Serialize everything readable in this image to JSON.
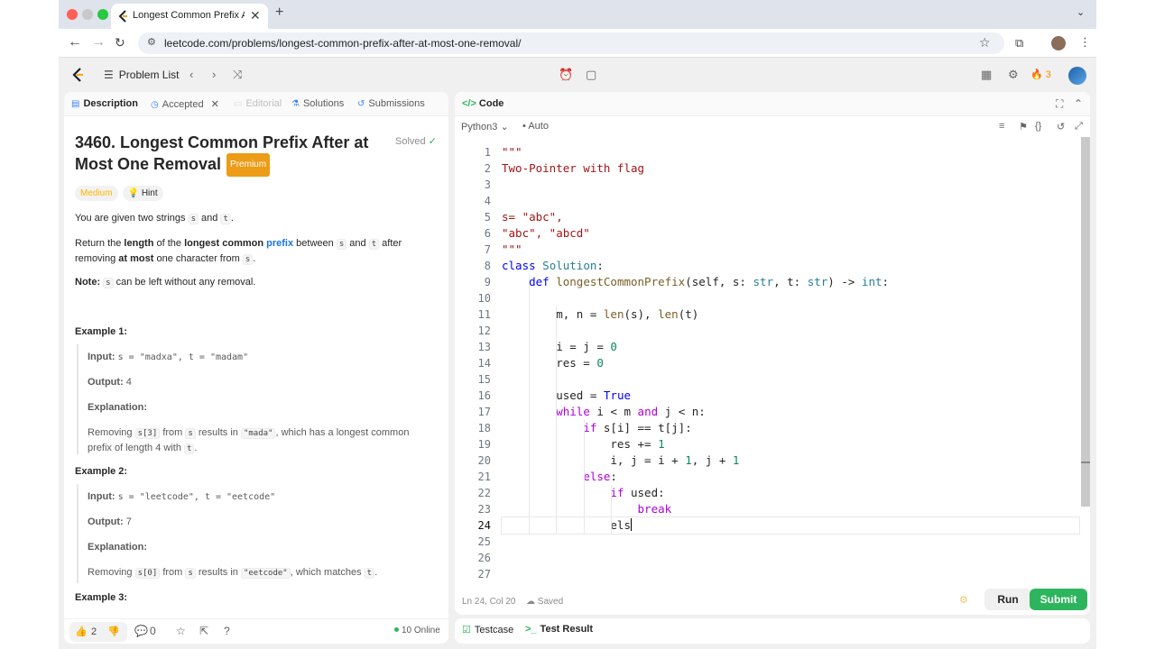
{
  "browser": {
    "tab_title": "Longest Common Prefix After",
    "tab_close": "✕",
    "new_tab": "+",
    "url": "leetcode.com/problems/longest-common-prefix-after-at-most-one-removal/",
    "colors": {
      "close": "#ff5f57",
      "min": "#febc2e",
      "max": "#28c840"
    }
  },
  "nav": {
    "problem_list": "Problem List",
    "streak_count": "3"
  },
  "left_tabs": {
    "description": "Description",
    "accepted": "Accepted",
    "editorial": "Editorial",
    "solutions": "Solutions",
    "submissions": "Submissions"
  },
  "problem": {
    "title": "3460. Longest Common Prefix After at Most One Removal",
    "premium": "Premium",
    "solved": "Solved",
    "difficulty": "Medium",
    "hint": "Hint",
    "intro_a": "You are given two strings ",
    "intro_s": "s",
    "intro_and": " and ",
    "intro_t": "t",
    "intro_end": ".",
    "ret_1": "Return the ",
    "ret_length": "length",
    "ret_2": " of the ",
    "ret_longest": "longest common",
    "ret_prefix": "prefix",
    "ret_3": " between ",
    "ret_s": "s",
    "ret_4": " and ",
    "ret_t": "t",
    "ret_5": " after removing ",
    "ret_most": "at most",
    "ret_6": " one character from ",
    "ret_s2": "s",
    "ret_7": ".",
    "note_label": "Note:",
    "note_s": "s",
    "note_text": " can be left without any removal."
  },
  "examples": {
    "ex1_title": "Example 1:",
    "ex1_input_label": "Input:",
    "ex1_input": "s = \"madxa\", t = \"madam\"",
    "ex1_output_label": "Output:",
    "ex1_output": "4",
    "ex1_expl_label": "Explanation:",
    "ex1_expl_a": "Removing ",
    "ex1_expl_code1": "s[3]",
    "ex1_expl_b": " from ",
    "ex1_expl_code2": "s",
    "ex1_expl_c": " results in ",
    "ex1_expl_code3": "\"mada\"",
    "ex1_expl_d": ", which has a longest common prefix of length 4 with ",
    "ex1_expl_code4": "t",
    "ex1_expl_e": ".",
    "ex2_title": "Example 2:",
    "ex2_input_label": "Input:",
    "ex2_input": "s = \"leetcode\", t = \"eetcode\"",
    "ex2_output_label": "Output:",
    "ex2_output": "7",
    "ex2_expl_label": "Explanation:",
    "ex2_expl_a": "Removing ",
    "ex2_expl_code1": "s[0]",
    "ex2_expl_b": " from ",
    "ex2_expl_code2": "s",
    "ex2_expl_c": " results in ",
    "ex2_expl_code3": "\"eetcode\"",
    "ex2_expl_d": ", which matches ",
    "ex2_expl_code4": "t",
    "ex2_expl_e": ".",
    "ex3_title": "Example 3:"
  },
  "left_footer": {
    "likes": "2",
    "comments": "0",
    "online": "10 Online"
  },
  "code_panel": {
    "title": "Code",
    "language": "Python3",
    "auto": "Auto",
    "status": "Ln 24, Col 20",
    "saved": "Saved",
    "run": "Run",
    "submit": "Submit"
  },
  "code_lines": [
    "\"\"\"",
    "Two-Pointer with flag",
    "",
    "",
    "s= \"abc\",",
    "\"abc\", \"abcd\"",
    "\"\"\"",
    "class Solution:",
    "    def longestCommonPrefix(self, s: str, t: str) -> int:",
    "",
    "        m, n = len(s), len(t)",
    "",
    "        i = j = 0",
    "        res = 0",
    "",
    "        used = True",
    "        while i < m and j < n:",
    "            if s[i] == t[j]:",
    "                res += 1",
    "                i, j = i + 1, j + 1",
    "            else:",
    "                if used:",
    "                    break",
    "                els",
    "",
    "",
    ""
  ],
  "bottom_tabs": {
    "testcase": "Testcase",
    "test_result": "Test Result"
  },
  "icons": {
    "problem_list": "list-icon",
    "prev": "chevron-left-icon",
    "next": "chevron-right-icon",
    "random": "shuffle-icon",
    "timer": "alarm-icon",
    "notes": "note-icon",
    "layout": "layout-icon",
    "settings": "gear-icon",
    "streak": "fire-icon"
  },
  "colors": {
    "accent_green": "#2db55d",
    "premium": "#ec9c17",
    "medium": "#ffb800",
    "keyword": "#0000ff",
    "control": "#af00db",
    "string": "#a31515",
    "builtin": "#795e26",
    "type": "#267f99",
    "number": "#098658"
  }
}
